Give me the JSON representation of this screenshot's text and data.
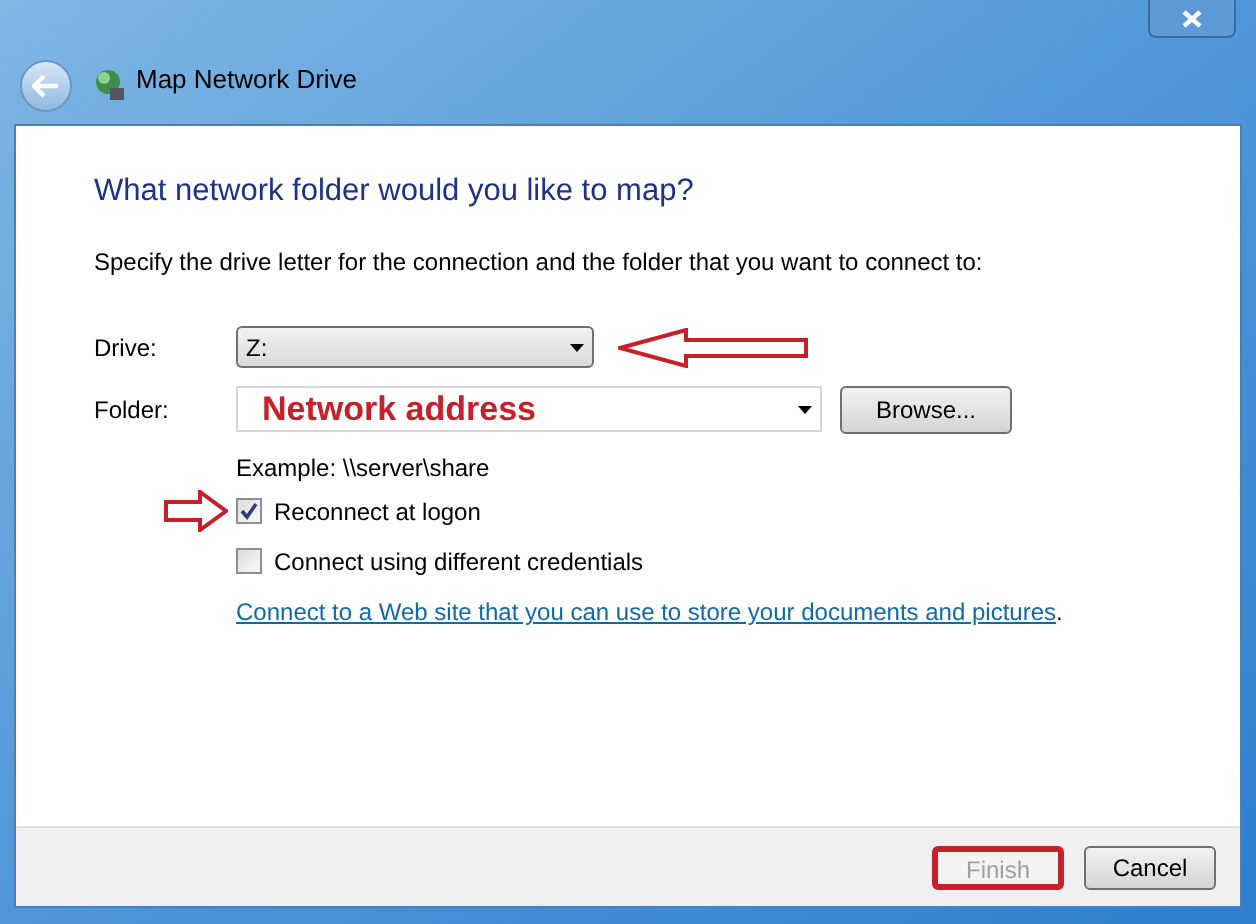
{
  "window": {
    "title": "Map Network Drive"
  },
  "heading": "What network folder would you like to map?",
  "instruction": "Specify the drive letter for the connection and the folder that you want to connect to:",
  "drive": {
    "label": "Drive:",
    "value": "Z:",
    "highlighted": true
  },
  "folder": {
    "label": "Folder:",
    "value": "Network address"
  },
  "browse_button": "Browse...",
  "example": "Example: \\\\server\\share",
  "options": [
    {
      "label": "Reconnect at logon",
      "checked": true,
      "highlighted": true
    },
    {
      "label": "Connect using different credentials",
      "checked": false,
      "highlighted": false
    }
  ],
  "link": {
    "text": "Connect to a Web site that you can use to store your documents and pictures",
    "suffix": "."
  },
  "buttons": [
    {
      "label": "Finish",
      "disabled": true,
      "highlighted": true
    },
    {
      "label": "Cancel",
      "disabled": false,
      "highlighted": false
    }
  ]
}
